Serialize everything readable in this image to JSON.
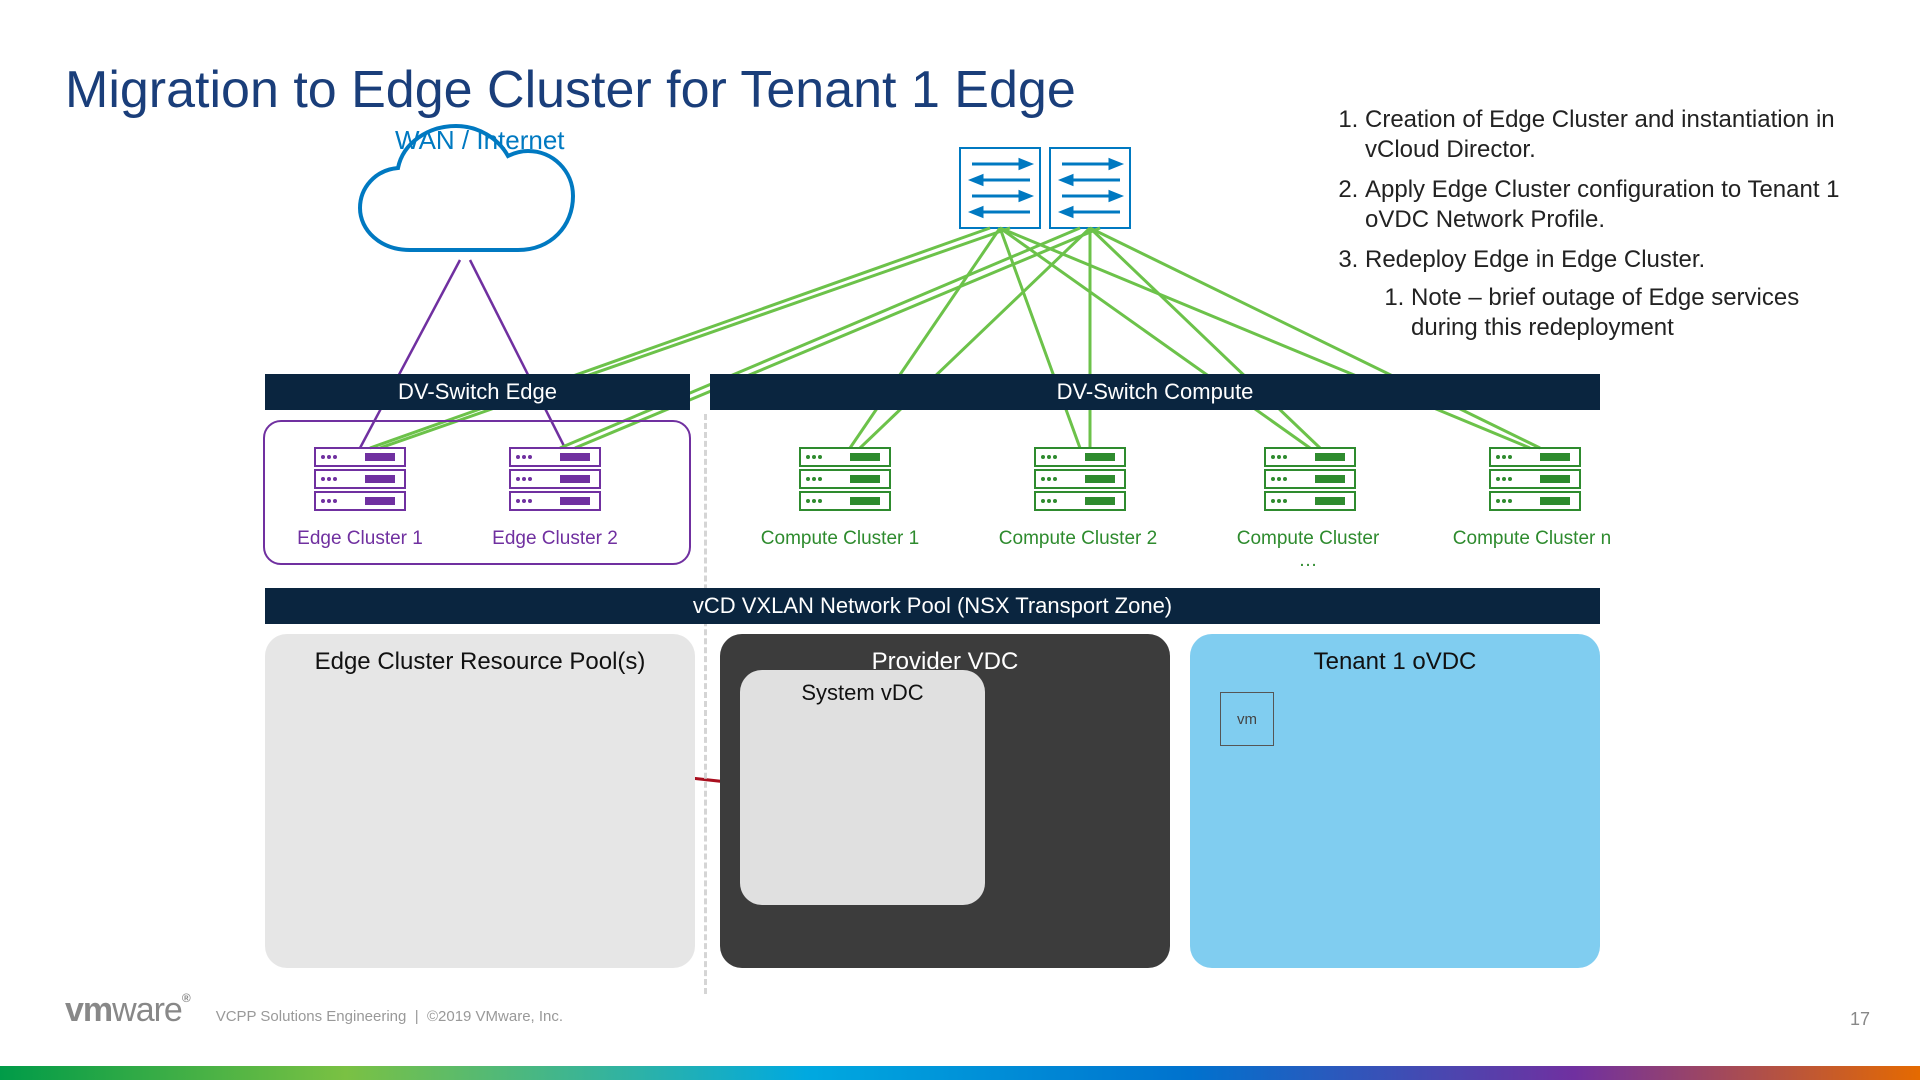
{
  "title": "Migration to Edge Cluster for Tenant 1 Edge",
  "wan_label": "WAN / Internet",
  "bars": {
    "edge": "DV-Switch Edge",
    "compute": "DV-Switch Compute",
    "pool": "vCD VXLAN Network Pool (NSX Transport Zone)"
  },
  "clusters": {
    "edge1": "Edge Cluster 1",
    "edge2": "Edge Cluster 2",
    "c1": "Compute Cluster 1",
    "c2": "Compute Cluster 2",
    "c3": "Compute Cluster …",
    "cn": "Compute Cluster n"
  },
  "boxes": {
    "rp": "Edge Cluster Resource Pool(s)",
    "pvdc": "Provider VDC",
    "sysvdc": "System vDC",
    "tenant": "Tenant 1 oVDC",
    "vm": "vm"
  },
  "bullets": {
    "b1": "Creation of Edge Cluster and instantiation in vCloud Director.",
    "b2": "Apply Edge Cluster configuration to Tenant 1 oVDC Network Profile.",
    "b3": "Redeploy Edge in Edge Cluster.",
    "b3_1": "Note – brief outage of Edge services during this redeployment"
  },
  "footer": {
    "dept": "VCPP Solutions Engineering",
    "copyright": "©2019 VMware, Inc.",
    "page": "17"
  }
}
